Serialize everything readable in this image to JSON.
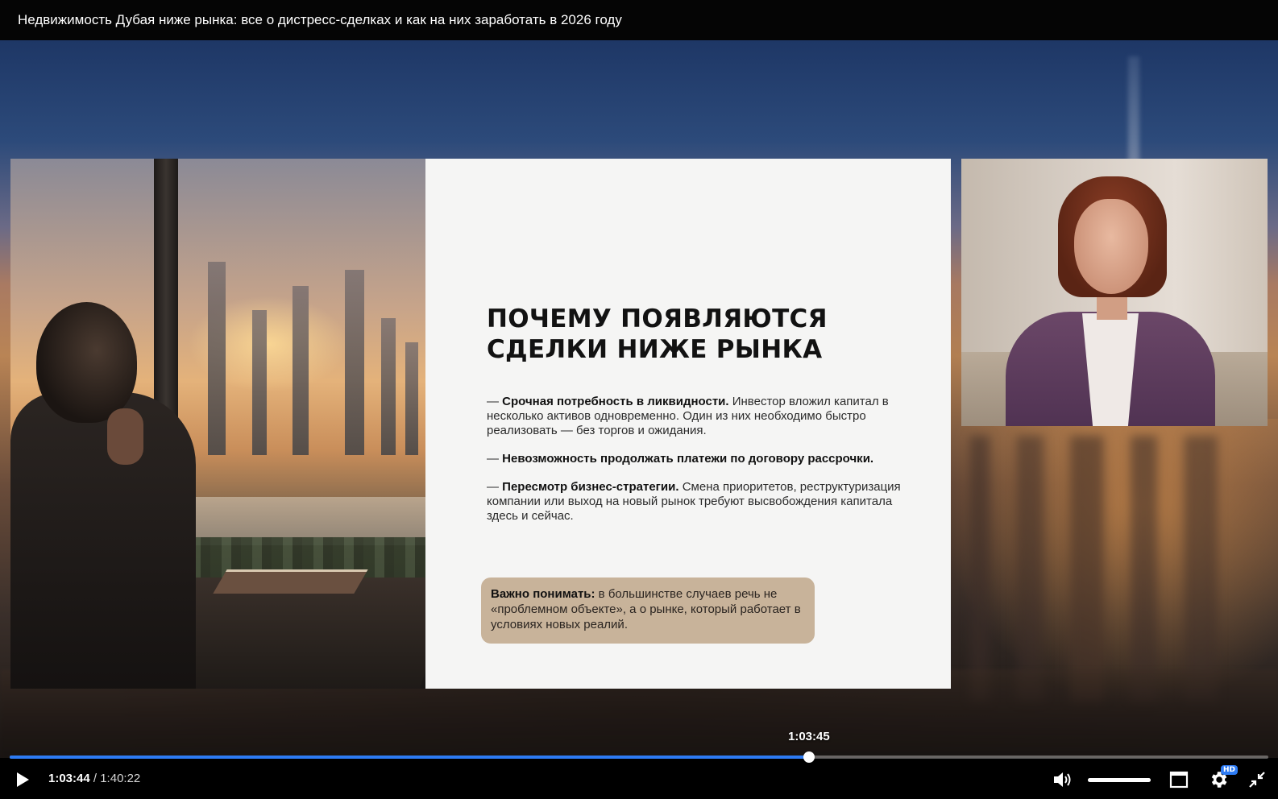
{
  "video": {
    "title": "Недвижимость Дубая ниже рынка: все о дистресс-сделках и как на них заработать в 2026 году"
  },
  "slide": {
    "heading_line1": "ПОЧЕМУ ПОЯВЛЯЮТСЯ",
    "heading_line2": "СДЕЛКИ НИЖЕ РЫНКА",
    "bullets": [
      {
        "lead": "— ",
        "bold": "Срочная потребность в ликвидности.",
        "text": " Инвестор вложил капитал в несколько активов одновременно. Один из них необходимо быстро реализовать — без торгов и ожидания."
      },
      {
        "lead": "— ",
        "bold": "Невозможность продолжать платежи по договору рассрочки.",
        "text": ""
      },
      {
        "lead": "— ",
        "bold": "Пересмотр бизнес-стратегии.",
        "text": " Смена приоритетов, реструктуризация компании или выход на новый рынок требуют высвобождения капитала здесь и сейчас."
      }
    ],
    "note_bold": "Важно понимать:",
    "note_text": " в большинстве случаев речь не «проблемном объекте», а о рынке, который работает в условиях новых реалий."
  },
  "player": {
    "current_time": "1:03:44",
    "separator": " / ",
    "duration": "1:40:22",
    "hover_time": "1:03:45",
    "progress_fraction": 0.635,
    "volume_fraction": 1.0,
    "quality_badge": "HD",
    "accent_color": "#2d7bf4",
    "icons": {
      "play": "play-icon",
      "volume": "volume-icon",
      "theater": "theater-mode-icon",
      "settings": "gear-icon",
      "exit_fullscreen": "exit-fullscreen-icon"
    }
  }
}
